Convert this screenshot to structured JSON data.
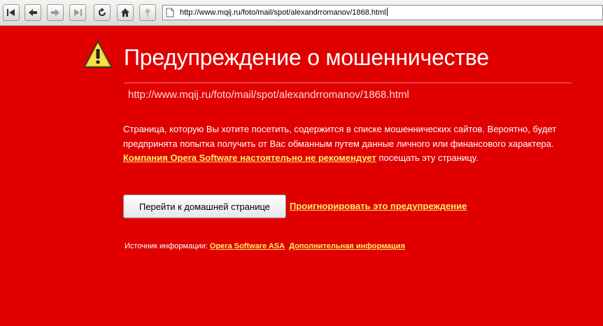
{
  "browser": {
    "address": "http://www.mqij.ru/foto/mail/spot/alexandrromanov/1868.html",
    "buttons": [
      "rewind-icon",
      "back-icon",
      "forward-icon",
      "fast-forward-icon",
      "reload-icon",
      "home-icon",
      "wand-icon"
    ]
  },
  "warning": {
    "title": "Предупреждение о мошенничестве",
    "url": "http://www.mqij.ru/foto/mail/spot/alexandrromanov/1868.html",
    "description_part1": "Страница, которую Вы хотите посетить, содержится в списке мошеннических сайтов. Вероятно, будет предпринята попытка получить от Вас обманным путем данные личного или финансового характера. ",
    "description_link": "Компания Opera Software настоятельно не рекомендует",
    "description_part2": " посещать эту страницу.",
    "home_button": "Перейти к домашней странице",
    "ignore_link": "Проигнорировать это предупреждение",
    "source_label": "Источник информации: ",
    "source_link": "Opera Software ASA",
    "more_info_link": "Дополнительная информация"
  },
  "colors": {
    "background": "#e00000",
    "link": "#ffee66"
  }
}
